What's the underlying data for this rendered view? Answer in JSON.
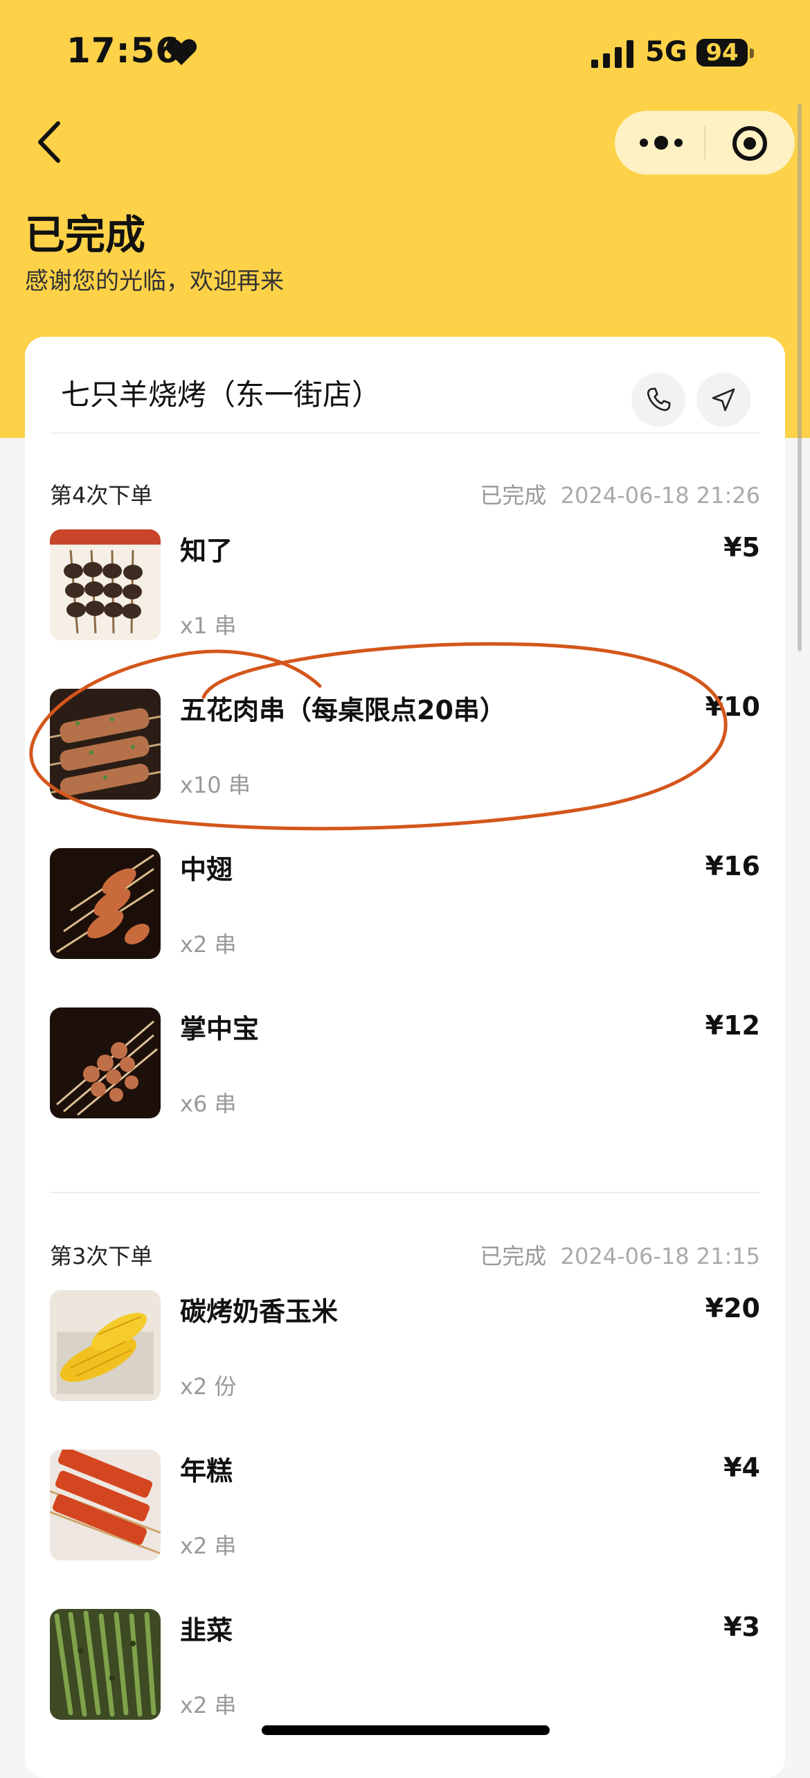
{
  "status_bar": {
    "time": "17:56",
    "network": "5G",
    "battery": "94"
  },
  "header": {
    "title": "已完成",
    "subtitle": "感谢您的光临，欢迎再来"
  },
  "shop": {
    "name": "七只羊烧烤（东一街店）"
  },
  "orders": [
    {
      "count_label": "第4次下单",
      "status": "已完成",
      "time": "2024-06-18 21:26",
      "items": [
        {
          "name": "知了",
          "qty": "x1 串",
          "price": "¥5"
        },
        {
          "name": "五花肉串（每桌限点20串）",
          "qty": "x10 串",
          "price": "¥10"
        },
        {
          "name": "中翅",
          "qty": "x2 串",
          "price": "¥16"
        },
        {
          "name": "掌中宝",
          "qty": "x6 串",
          "price": "¥12"
        }
      ]
    },
    {
      "count_label": "第3次下单",
      "status": "已完成",
      "time": "2024-06-18 21:15",
      "items": [
        {
          "name": "碳烤奶香玉米",
          "qty": "x2 份",
          "price": "¥20"
        },
        {
          "name": "年糕",
          "qty": "x2 串",
          "price": "¥4"
        },
        {
          "name": "韭菜",
          "qty": "x2 串",
          "price": "¥3"
        }
      ]
    }
  ],
  "colors": {
    "brand_yellow": "#fdd248",
    "annotation": "#d4561b"
  }
}
